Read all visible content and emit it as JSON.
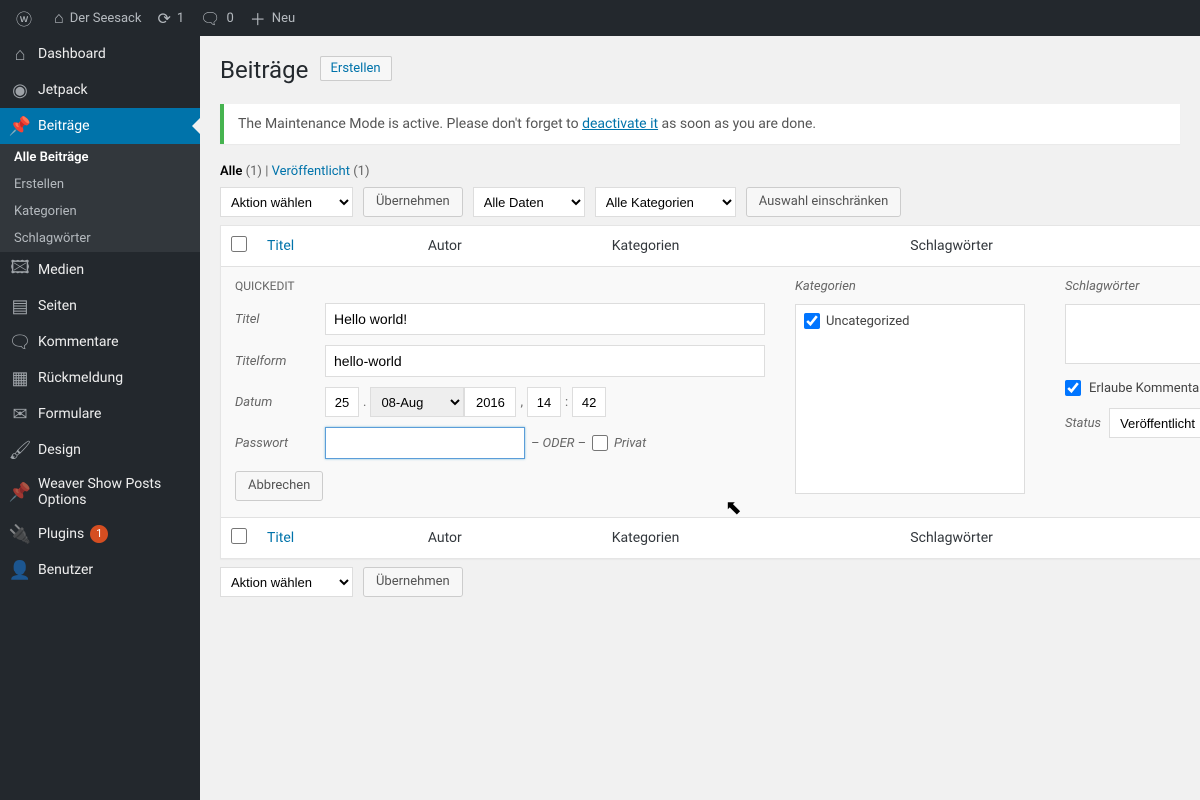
{
  "adminbar": {
    "site_name": "Der Seesack",
    "updates_count": "1",
    "comments_count": "0",
    "new_label": "Neu"
  },
  "sidebar": {
    "items": [
      {
        "icon": "⌂",
        "label": "Dashboard"
      },
      {
        "icon": "◉",
        "label": "Jetpack"
      },
      {
        "icon": "📌",
        "label": "Beiträge",
        "current": true,
        "sub": [
          {
            "label": "Alle Beiträge",
            "current": true
          },
          {
            "label": "Erstellen"
          },
          {
            "label": "Kategorien"
          },
          {
            "label": "Schlagwörter"
          }
        ]
      },
      {
        "icon": "🖾",
        "label": "Medien"
      },
      {
        "icon": "▤",
        "label": "Seiten"
      },
      {
        "icon": "🗨",
        "label": "Kommentare"
      },
      {
        "icon": "▦",
        "label": "Rückmeldung"
      },
      {
        "icon": "✉",
        "label": "Formulare"
      },
      {
        "icon": "🖌",
        "label": "Design"
      },
      {
        "icon": "📌",
        "label": "Weaver Show Posts Options"
      },
      {
        "icon": "🔌",
        "label": "Plugins",
        "badge": "1"
      },
      {
        "icon": "👤",
        "label": "Benutzer"
      }
    ]
  },
  "page": {
    "title": "Beiträge",
    "add_new": "Erstellen"
  },
  "notice": {
    "text_before": "The Maintenance Mode is active. Please don't forget to ",
    "link": "deactivate it",
    "text_after": " as soon as you are done."
  },
  "filters": {
    "all_label": "Alle",
    "all_count": "(1)",
    "sep": " | ",
    "published_label": "Veröffentlicht",
    "published_count": "(1)"
  },
  "bulk": {
    "action_placeholder": "Aktion wählen",
    "apply": "Übernehmen",
    "date_filter": "Alle Daten",
    "cat_filter": "Alle Kategorien",
    "filter_btn": "Auswahl einschränken"
  },
  "columns": {
    "title": "Titel",
    "author": "Autor",
    "categories": "Kategorien",
    "tags": "Schlagwörter"
  },
  "quickedit": {
    "heading": "QUICKEDIT",
    "title_label": "Titel",
    "title_value": "Hello world!",
    "slug_label": "Titelform",
    "slug_value": "hello-world",
    "date_label": "Datum",
    "day": "25",
    "month": "08-Aug",
    "year": "2016",
    "hour": "14",
    "minute": "42",
    "password_label": "Passwort",
    "password_value": "",
    "or_label": "– ODER –",
    "private_label": "Privat",
    "cats_heading": "Kategorien",
    "cat_uncategorized": "Uncategorized",
    "tags_heading": "Schlagwörter",
    "allow_comments": "Erlaube Kommentare",
    "status_label": "Status",
    "status_value": "Veröffentlicht",
    "cancel": "Abbrechen"
  }
}
